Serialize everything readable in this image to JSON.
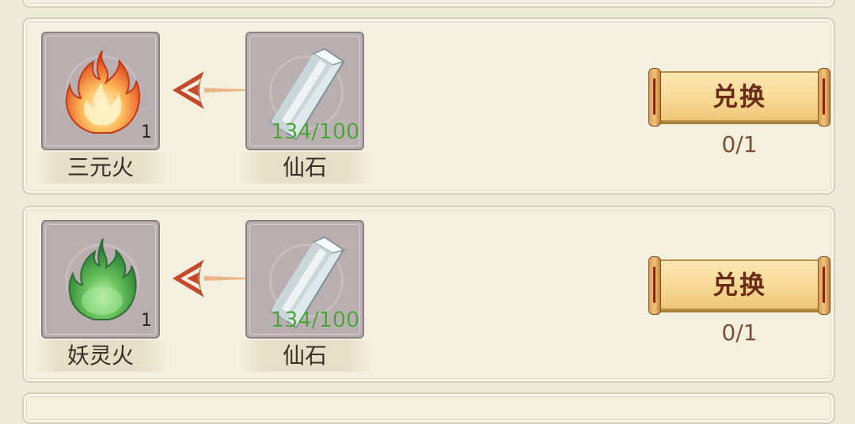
{
  "rows": [
    {
      "target": {
        "name": "三元火",
        "count": "1",
        "icon": "orange-flame-icon"
      },
      "cost": {
        "name": "仙石",
        "qty": "134/100",
        "icon": "crystal-icon"
      },
      "button": {
        "label": "兑换"
      },
      "progress": "0/1"
    },
    {
      "target": {
        "name": "妖灵火",
        "count": "1",
        "icon": "green-flame-icon"
      },
      "cost": {
        "name": "仙石",
        "qty": "134/100",
        "icon": "crystal-icon"
      },
      "button": {
        "label": "兑换"
      },
      "progress": "0/1"
    }
  ],
  "colors": {
    "panel_bg": "#f4f0df",
    "qty_green": "#4aa03b",
    "button_text": "#6a2c16",
    "progress_text": "#7a4f34"
  }
}
